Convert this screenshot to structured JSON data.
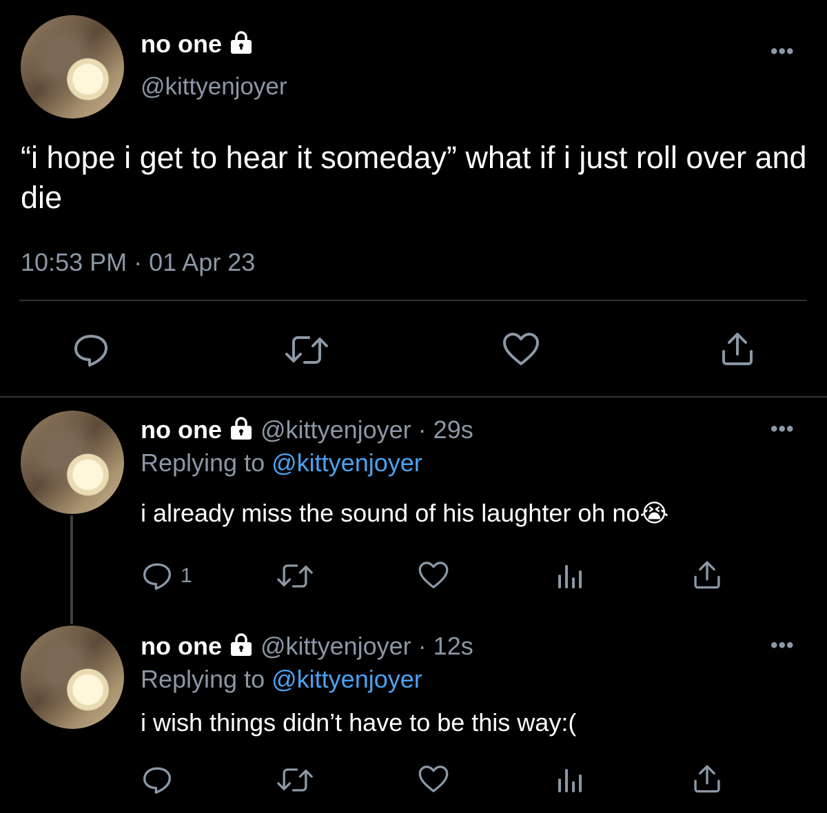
{
  "main_tweet": {
    "display_name": "no one",
    "handle": "@kittyenjoyer",
    "text": "“i hope i get to hear it someday” what if i just roll over and die",
    "time": "10:53 PM",
    "separator": "·",
    "date": "01 Apr 23",
    "more_label": "•••"
  },
  "replies": [
    {
      "display_name": "no one",
      "handle": "@kittyenjoyer",
      "separator": "·",
      "age": "29s",
      "replying_prefix": "Replying to",
      "replying_to": "@kittyenjoyer",
      "text": "i already miss the sound of his laughter oh no😭",
      "reply_count": "1",
      "more_label": "•••"
    },
    {
      "display_name": "no one",
      "handle": "@kittyenjoyer",
      "separator": "·",
      "age": "12s",
      "replying_prefix": "Replying to",
      "replying_to": "@kittyenjoyer",
      "text": "i wish things didn’t have to be this way:(",
      "reply_count": "",
      "more_label": "•••"
    }
  ],
  "icons": {
    "reply": "reply-icon",
    "retweet": "retweet-icon",
    "like": "like-icon",
    "views": "views-icon",
    "share": "share-icon",
    "lock": "lock-icon",
    "more": "more-icon"
  },
  "colors": {
    "background": "#000000",
    "text": "#e7e9ea",
    "muted": "#8b98a5",
    "link": "#4aa3f0",
    "divider": "#2f3336"
  }
}
